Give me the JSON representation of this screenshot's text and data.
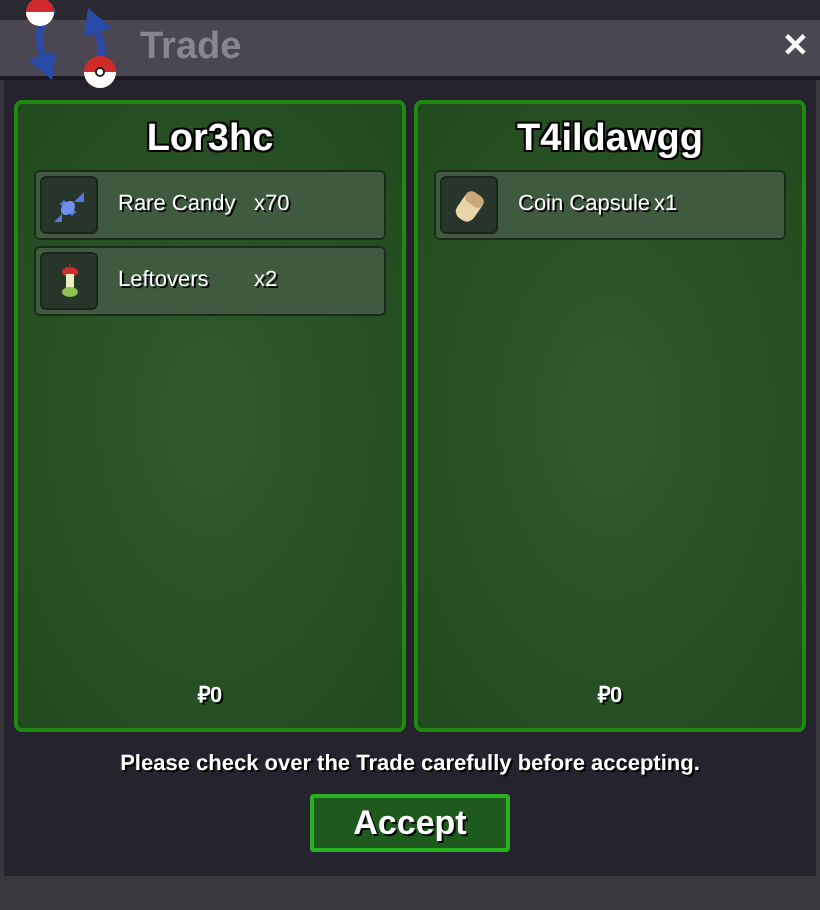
{
  "window": {
    "title": "Trade",
    "close": "✕"
  },
  "panels": [
    {
      "player": "Lor3hc",
      "money": "₽0",
      "items": [
        {
          "kind": "candy",
          "name": "Rare Candy",
          "count": "x70"
        },
        {
          "kind": "core",
          "name": "Leftovers",
          "count": "x2"
        }
      ]
    },
    {
      "player": "T4ildawgg",
      "money": "₽0",
      "items": [
        {
          "kind": "capsule",
          "name": "Coin Capsule",
          "count": "x1"
        }
      ]
    }
  ],
  "notice": "Please check over the Trade carefully before accepting.",
  "button": "Accept"
}
